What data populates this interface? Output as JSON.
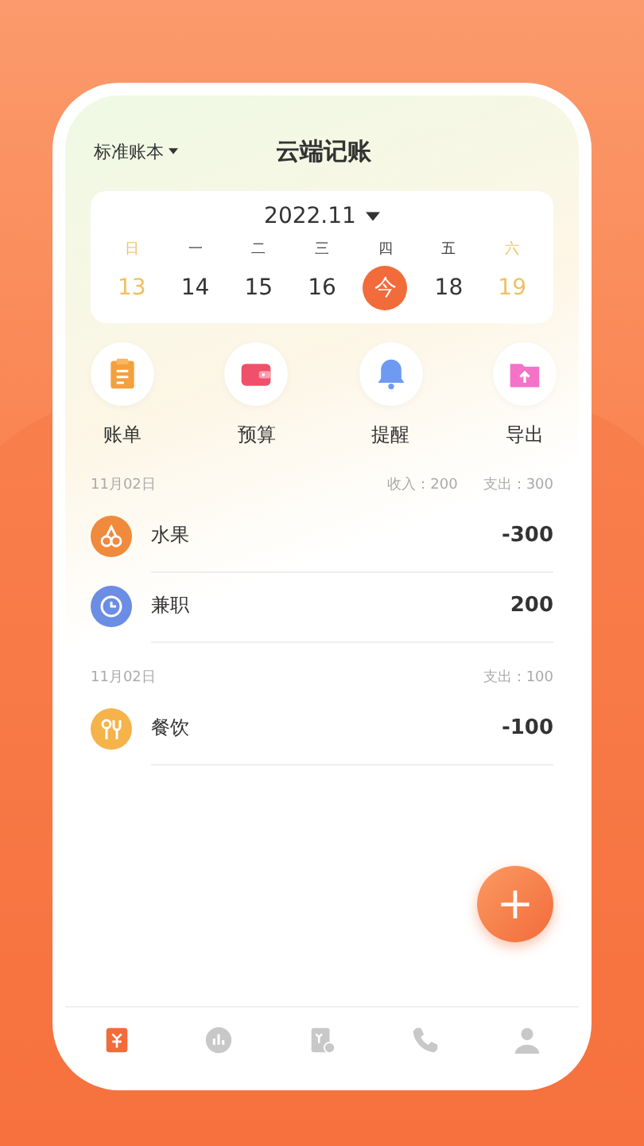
{
  "header": {
    "book_selector": "标准账本",
    "title": "云端记账"
  },
  "calendar": {
    "month": "2022.11",
    "days": [
      {
        "weekday": "日",
        "date": "13",
        "weekend": true,
        "selected": false
      },
      {
        "weekday": "一",
        "date": "14",
        "weekend": false,
        "selected": false
      },
      {
        "weekday": "二",
        "date": "15",
        "weekend": false,
        "selected": false
      },
      {
        "weekday": "三",
        "date": "16",
        "weekend": false,
        "selected": false
      },
      {
        "weekday": "四",
        "date": "今",
        "weekend": false,
        "selected": true
      },
      {
        "weekday": "五",
        "date": "18",
        "weekend": false,
        "selected": false
      },
      {
        "weekday": "六",
        "date": "19",
        "weekend": true,
        "selected": false
      }
    ]
  },
  "shortcuts": [
    {
      "kind": "bill",
      "label": "账单"
    },
    {
      "kind": "wallet",
      "label": "预算"
    },
    {
      "kind": "bell",
      "label": "提醒"
    },
    {
      "kind": "export",
      "label": "导出"
    }
  ],
  "groups": [
    {
      "date": "11月02日",
      "income": "收入：200",
      "expense": "支出：300",
      "records": [
        {
          "kind": "fruit",
          "name": "水果",
          "amount": "-300",
          "color": "#f08a3c"
        },
        {
          "kind": "clock",
          "name": "兼职",
          "amount": "200",
          "color": "#6b8de3"
        }
      ]
    },
    {
      "date": "11月02日",
      "expense": "支出：100",
      "records": [
        {
          "kind": "food",
          "name": "餐饮",
          "amount": "-100",
          "color": "#f5b34a"
        }
      ]
    }
  ],
  "add_button": "+",
  "nav": [
    {
      "kind": "ledger",
      "selected": true
    },
    {
      "kind": "chart",
      "selected": false
    },
    {
      "kind": "report",
      "selected": false
    },
    {
      "kind": "phone",
      "selected": false
    },
    {
      "kind": "user",
      "selected": false
    }
  ]
}
